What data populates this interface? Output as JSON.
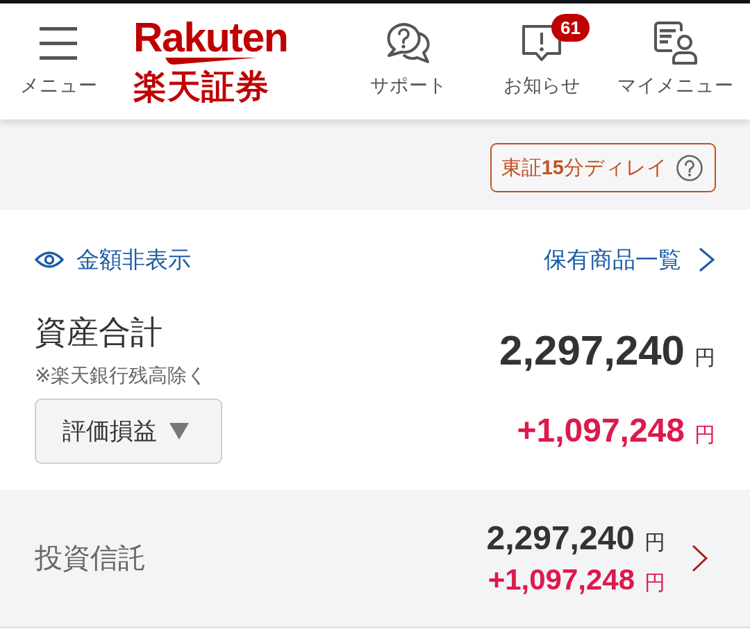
{
  "header": {
    "menu": {
      "label": "メニュー"
    },
    "logo": {
      "wordmark": "Rakuten",
      "subtitle": "楽天証券"
    },
    "nav_items": [
      {
        "kind": "support",
        "label": "サポート"
      },
      {
        "kind": "notice",
        "label": "お知らせ",
        "badge": "61"
      },
      {
        "kind": "mymenu",
        "label": "マイメニュー"
      }
    ]
  },
  "delay_notice": {
    "label": "東証**15**分ディレイ"
  },
  "summary": {
    "hide_toggle": {
      "label": "金額非表示"
    },
    "holdings_link": {
      "label": "保有商品一覧"
    },
    "title": "資産合計",
    "note": "※楽天銀行残高除く",
    "metric_select": {
      "value": "評価損益"
    },
    "total": {
      "amount": "2,297,240",
      "unit": "円"
    },
    "gain": {
      "amount": "+1,097,248",
      "unit": "円"
    }
  },
  "asset_rows": [
    {
      "name": "投資信託",
      "amount": "2,297,240",
      "amount_unit": "円",
      "gain": "+1,097,248",
      "gain_unit": "円"
    }
  ]
}
